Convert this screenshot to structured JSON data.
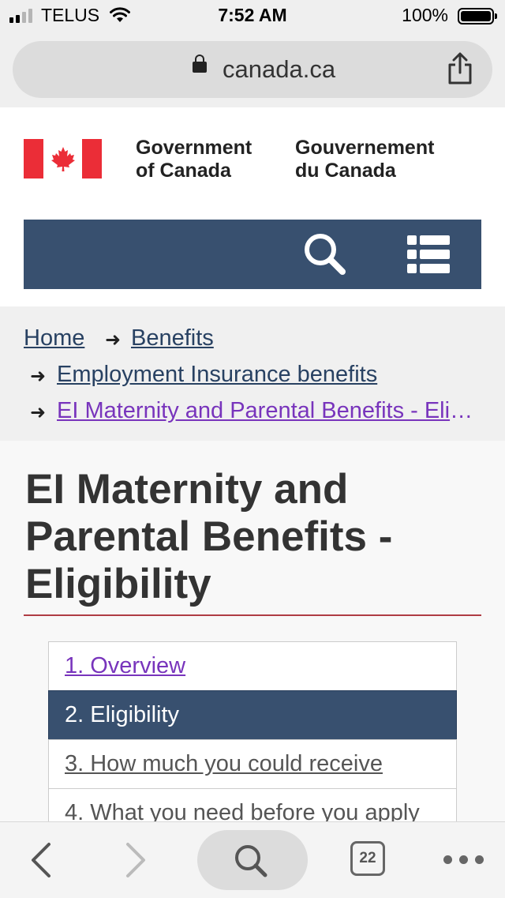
{
  "status_bar": {
    "carrier": "TELUS",
    "time": "7:52 AM",
    "battery_percent": "100%",
    "signal_bars": 4,
    "signal_bars_filled": 2,
    "icons": [
      "signal-icon",
      "wifi-icon",
      "battery-icon"
    ]
  },
  "browser": {
    "url": "canada.ca",
    "lock_icon": "lock-icon",
    "share_icon": "share-icon"
  },
  "header": {
    "gov_en_line1": "Government",
    "gov_en_line2": "of Canada",
    "gov_fr_line1": "Gouvernement",
    "gov_fr_line2": "du Canada",
    "flag_color": "#eb2d37",
    "nav_color": "#38506f",
    "icons": [
      "canada-flag-icon",
      "search-icon",
      "menu-icon"
    ]
  },
  "breadcrumb": {
    "items": [
      {
        "label": "Home"
      },
      {
        "label": "Benefits"
      },
      {
        "label": "Employment Insurance benefits"
      },
      {
        "label": "EI Maternity and Parental Benefits - Eligibility"
      }
    ],
    "link_color": "#284162",
    "visited_color": "#7834bc"
  },
  "main": {
    "title_line1": "EI Maternity and",
    "title_line2": "Parental Benefits -",
    "title_line3": "Eligibility",
    "rule_color": "#af3c43"
  },
  "toc": {
    "items": [
      {
        "label": "1. Overview",
        "state": "visited"
      },
      {
        "label": "2. Eligibility",
        "state": "active"
      },
      {
        "label": "3. How much you could receive",
        "state": "link"
      },
      {
        "label": "4. What you need before you apply",
        "state": "link"
      }
    ],
    "active_color": "#38506f"
  },
  "toolbar": {
    "tab_count": "22",
    "icons": [
      "back-icon",
      "forward-icon",
      "search-icon",
      "tabs-icon",
      "more-icon"
    ]
  }
}
